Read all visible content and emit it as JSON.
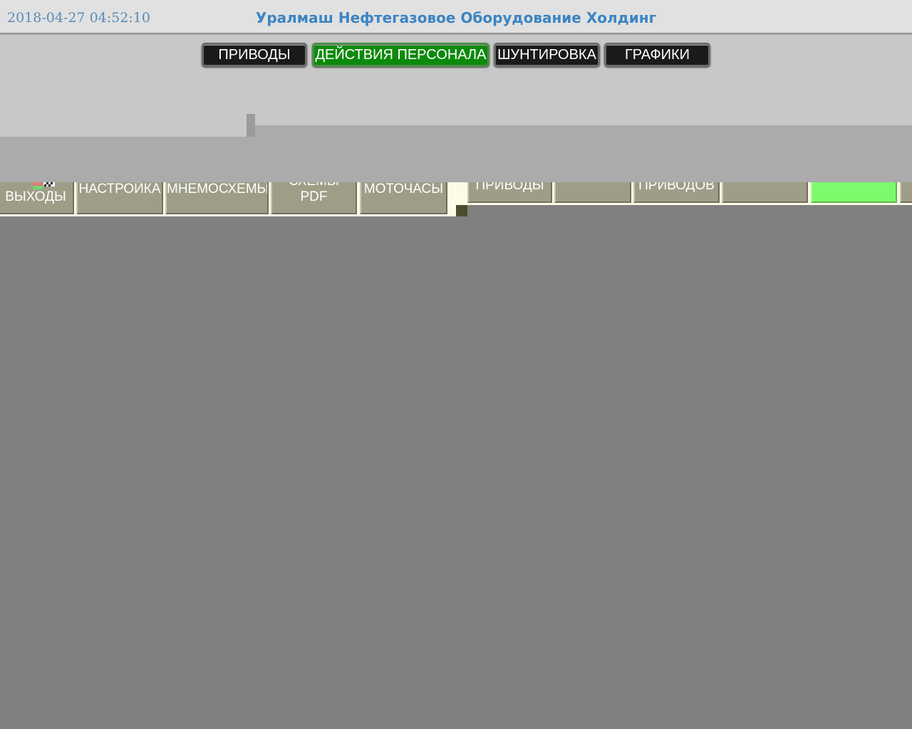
{
  "header": {
    "timestamp": "2018-04-27 04:52:10",
    "company": "Уралмаш Нефтегазовое Оборудование Холдинг"
  },
  "nav": {
    "drives": "ПРИВОДЫ",
    "staff_actions": "ДЕЙСТВИЯ ПЕРСОНАЛА",
    "bypass": "ШУНТИРОВКА",
    "charts": "ГРАФИКИ",
    "active": "ДЕЙСТВИЯ ПЕРСОНАЛА"
  },
  "panel_left": {
    "outputs": "ВЫХОДЫ",
    "settings": "НАСТРОЙКА",
    "mnemo": "МНЕМОСХЕМЫ",
    "schemes_top": "СХЕМЫ",
    "schemes_bottom": "PDF",
    "motohours": "МОТОЧАСЫ"
  },
  "panel_right": {
    "drives": "ПРИВОДЫ",
    "of_drives": "ПРИВОДОВ"
  },
  "colors": {
    "accent_blue": "#3b84c4",
    "active_green": "#0c8a0c",
    "indicator_green": "#7dfb6d"
  }
}
